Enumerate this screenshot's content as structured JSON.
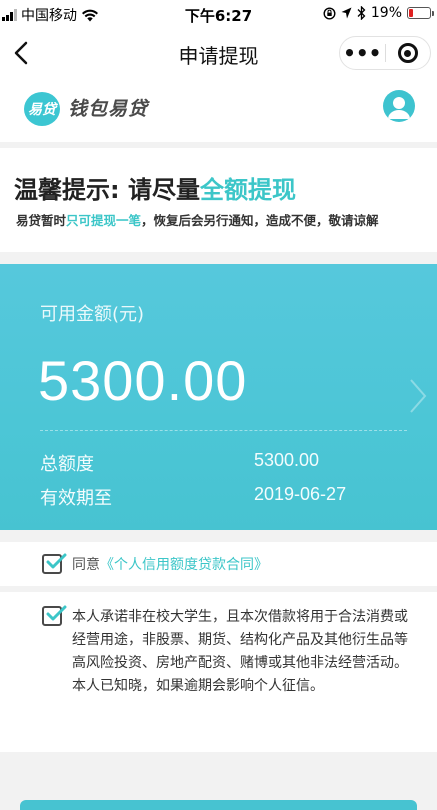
{
  "status_bar": {
    "carrier": "中国移动",
    "time": "下午6:27",
    "battery": "19%",
    "battery_level": 0.19
  },
  "nav": {
    "title": "申请提现",
    "more": "•••"
  },
  "brand": {
    "badge": "易贷",
    "name": "钱包易贷"
  },
  "tip": {
    "title_prefix": "温馨提示: 请尽量",
    "title_highlight": "全额提现",
    "text_prefix": "易贷暂时",
    "text_highlight": "只可提现一笔",
    "text_suffix": "，恢复后会另行通知，造成不便，敬请谅解"
  },
  "amount_card": {
    "available_label": "可用金额(元)",
    "available_amount": "5300.00",
    "total_label": "总额度",
    "total_value": "5300.00",
    "expiry_label": "有效期至",
    "expiry_value": "2019-06-27"
  },
  "agreement": {
    "prefix": "同意",
    "link": "《个人信用额度贷款合同》",
    "checked": true
  },
  "promise": {
    "text": "本人承诺非在校大学生，且本次借款将用于合法消费或经营用途，非股票、期货、结构化产品及其他衍生品等高风险投资、房地产配资、赌博或其他非法经营活动。本人已知晓，如果逾期会影响个人征信。",
    "checked": true
  },
  "colors": {
    "accent": "#3cc6c8",
    "card": "#4cc6d6"
  },
  "icons": {
    "wifi": "wifi-icon",
    "back": "back-arrow-icon",
    "close": "close-circle-icon",
    "avatar": "user-avatar-icon",
    "chevron": "chevron-right-icon",
    "check": "checkbox-checked-icon"
  }
}
